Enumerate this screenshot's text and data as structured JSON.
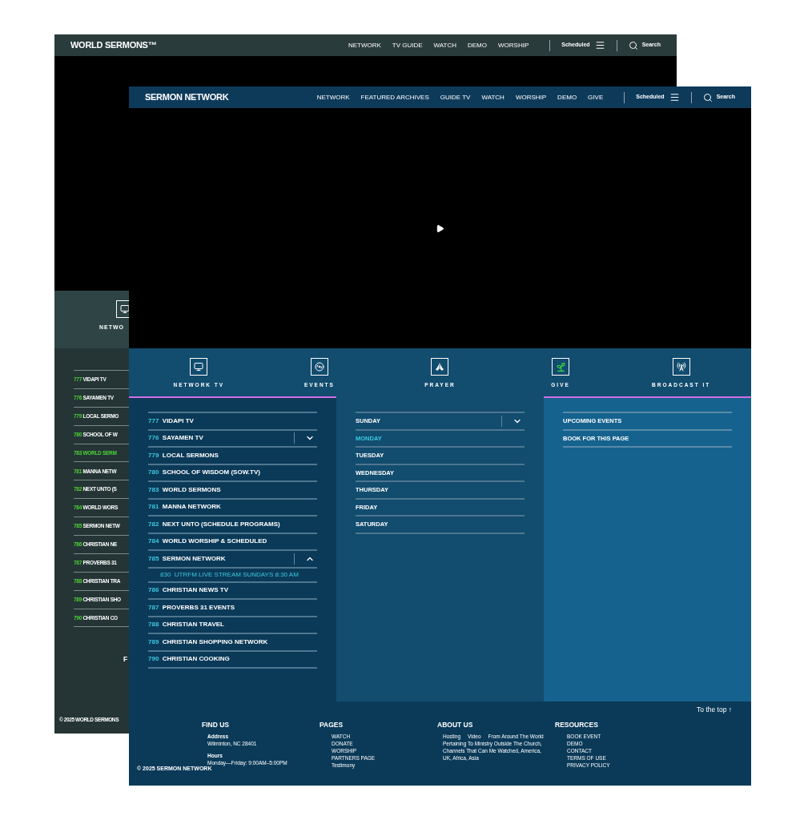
{
  "back_window": {
    "logo": "WORLD SERMONS™",
    "nav": [
      "NETWORK",
      "TV GUIDE",
      "WATCH",
      "DEMO",
      "WORSHIP"
    ],
    "scheduled": "Scheduled",
    "search": "Search",
    "tab_label": "NETWO",
    "channels": [
      {
        "number": "777",
        "name": "VIDAPI TV",
        "selected": false
      },
      {
        "number": "776",
        "name": "SAYAMEN TV",
        "selected": false
      },
      {
        "number": "779",
        "name": "LOCAL SERMO",
        "selected": false
      },
      {
        "number": "780",
        "name": "SCHOOL OF W",
        "selected": false
      },
      {
        "number": "783",
        "name": "WORLD SERM",
        "selected": true
      },
      {
        "number": "781",
        "name": "MANNA NETW",
        "selected": false
      },
      {
        "number": "782",
        "name": "NEXT UNTO (S",
        "selected": false
      },
      {
        "number": "784",
        "name": "WORLD WORS",
        "selected": false
      },
      {
        "number": "785",
        "name": "SERMON NETW",
        "selected": false
      },
      {
        "number": "786",
        "name": "CHRISTIAN NE",
        "selected": false
      },
      {
        "number": "787",
        "name": "PROVERBS 31",
        "selected": false
      },
      {
        "number": "788",
        "name": "CHRISTIAN TRA",
        "selected": false
      },
      {
        "number": "789",
        "name": "CHRISTIAN SHO",
        "selected": false
      },
      {
        "number": "790",
        "name": "CHRISTIAN CO",
        "selected": false
      }
    ],
    "footer_heading": "F",
    "copyright": "© 2025 WORLD SERMONS"
  },
  "front_window": {
    "logo": "SERMON NETWORK",
    "nav": [
      "NETWORK",
      "FEATURED ARCHIVES",
      "GUIDE TV",
      "WATCH",
      "WORSHIP",
      "DEMO",
      "GIVE"
    ],
    "scheduled": "Scheduled",
    "search": "Search",
    "tabs": [
      {
        "kind": "tv",
        "label": "NETWORK TV"
      },
      {
        "kind": "events",
        "label": "EVENTS"
      },
      {
        "kind": "prayer",
        "label": "PRAYER"
      },
      {
        "kind": "give",
        "label": "GIVE"
      },
      {
        "kind": "broadcast",
        "label": "BROADCAST IT"
      }
    ],
    "columns": [
      {
        "kind": "channels",
        "selected": true,
        "items": [
          {
            "number": "777",
            "name": "VIDAPI TV"
          },
          {
            "number": "776",
            "name": "SAYAMEN TV",
            "expanded": false
          },
          {
            "number": "779",
            "name": "LOCAL SERMONS"
          },
          {
            "number": "780",
            "name": "SCHOOL OF WISDOM (SOW.TV)"
          },
          {
            "number": "783",
            "name": "WORLD SERMONS"
          },
          {
            "number": "781",
            "name": "MANNA NETWORK"
          },
          {
            "number": "782",
            "name": "NEXT UNTO (SCHEDULE PROGRAMS)"
          },
          {
            "number": "784",
            "name": "WORLD WORSHIP & SCHEDULED"
          },
          {
            "number": "785",
            "name": "SERMON NETWORK",
            "expanded": true,
            "children": [
              {
                "number": "830",
                "name": "UTRFM LIVE STREAM SUNDAYS 8:30 AM"
              }
            ]
          },
          {
            "number": "786",
            "name": "CHRISTIAN NEWS TV"
          },
          {
            "number": "787",
            "name": "PROVERBS 31 EVENTS"
          },
          {
            "number": "788",
            "name": "CHRISTIAN TRAVEL"
          },
          {
            "number": "789",
            "name": "CHRISTIAN SHOPPING NETWORK"
          },
          {
            "number": "790",
            "name": "CHRISTIAN COOKING"
          }
        ]
      },
      {
        "kind": "days",
        "selected": false,
        "items": [
          {
            "label": "SUNDAY",
            "selected": false,
            "expanded": false
          },
          {
            "label": "MONDAY",
            "selected": true
          },
          {
            "label": "TUESDAY",
            "selected": false
          },
          {
            "label": "WEDNESDAY",
            "selected": false
          },
          {
            "label": "THURSDAY",
            "selected": false
          },
          {
            "label": "FRIDAY",
            "selected": false
          },
          {
            "label": "SATURDAY",
            "selected": false
          }
        ]
      },
      {
        "kind": "links",
        "selected": true,
        "items": [
          {
            "label": "UPCOMING EVENTS"
          },
          {
            "label": "BOOK FOR THIS PAGE"
          }
        ]
      }
    ],
    "to_top": "To the top ↑",
    "footer": [
      {
        "kind": "find",
        "heading": "FIND US",
        "groups": [
          {
            "title": "Address",
            "text": "Wilminton, NC 28401"
          },
          {
            "title": "Hours",
            "text": "Monday—Friday: 9:00AM–5:00PM"
          }
        ]
      },
      {
        "kind": "links",
        "heading": "PAGES",
        "links": [
          "WATCH",
          "DONATE",
          "WORSHIP",
          "PARTNERS PAGE",
          "Testimony"
        ]
      },
      {
        "kind": "about",
        "heading": "ABOUT US",
        "text": "Hosting     Video     From Around The World Pertaining To Ministry Outside The Church, Channels That Can Me Watched, America, UK, Africa, Asia"
      },
      {
        "kind": "links",
        "heading": "RESOURCES",
        "links": [
          "BOOK EVENT",
          "DEMO",
          "CONTACT",
          "TERMS OF USE",
          "PRIVACY POLICY"
        ]
      }
    ],
    "copyright": "© 2025 SERMON NETWORK"
  }
}
